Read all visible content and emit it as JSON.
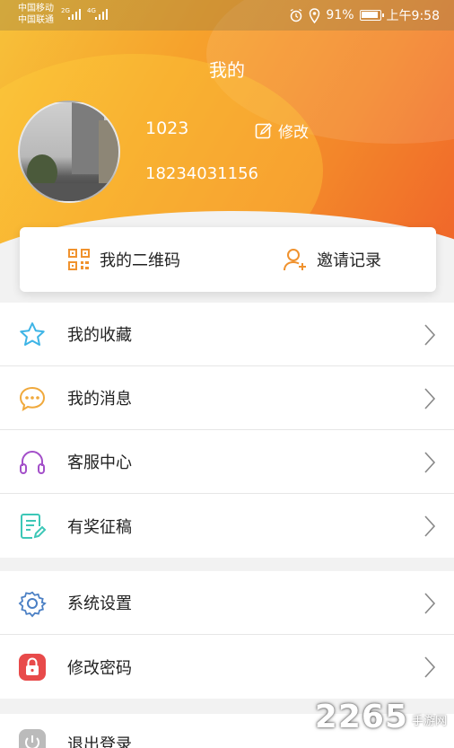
{
  "statusbar": {
    "carrier1": "中国移动",
    "carrier2": "中国联通",
    "net1": "2G",
    "net2": "4G",
    "battery": "91%",
    "time": "上午9:58"
  },
  "header": {
    "title": "我的",
    "username": "1023",
    "edit_label": "修改",
    "phone": "18234031156"
  },
  "card": {
    "qrcode_label": "我的二维码",
    "invite_label": "邀请记录"
  },
  "menu_group1": [
    {
      "label": "我的收藏",
      "icon": "star-icon",
      "color": "#3db4e6"
    },
    {
      "label": "我的消息",
      "icon": "chat-bubble-icon",
      "color": "#f0a93c"
    },
    {
      "label": "客服中心",
      "icon": "headset-icon",
      "color": "#a34fc9"
    },
    {
      "label": "有奖征稿",
      "icon": "document-edit-icon",
      "color": "#3dc7b7"
    }
  ],
  "menu_group2": [
    {
      "label": "系统设置",
      "icon": "gear-icon",
      "color": "#4a7fc4"
    },
    {
      "label": "修改密码",
      "icon": "lock-icon",
      "color": "#e84a4a"
    }
  ],
  "logout": {
    "label": "退出登录",
    "icon": "power-icon",
    "color": "#bbbbbb"
  },
  "watermark": {
    "number": "2265",
    "text": "手游网"
  }
}
